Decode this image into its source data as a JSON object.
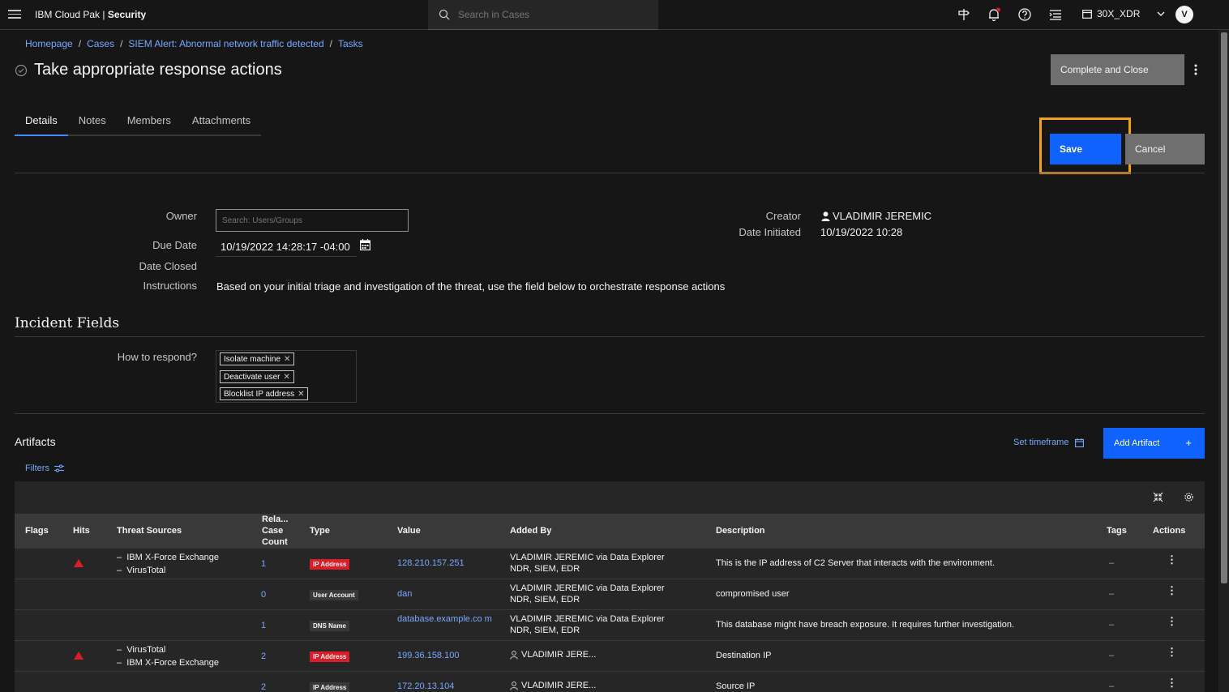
{
  "topbar": {
    "brand_prefix": "IBM Cloud Pak | ",
    "brand_name": "Security",
    "search_placeholder": "Search in Cases",
    "tenant": "30X_XDR",
    "avatar_initial": "V"
  },
  "breadcrumb": [
    "Homepage",
    "Cases",
    "SIEM Alert: Abnormal network traffic detected",
    "Tasks"
  ],
  "breadcrumb_separator": "/",
  "page_title": "Take appropriate response actions",
  "actions": {
    "complete_label": "Complete and Close",
    "save_label": "Save",
    "cancel_label": "Cancel"
  },
  "tabs": [
    "Details",
    "Notes",
    "Members",
    "Attachments"
  ],
  "form": {
    "owner_label": "Owner",
    "owner_placeholder": "Search: Users/Groups",
    "due_label": "Due Date",
    "due_value": "10/19/2022 14:28:17 -04:00",
    "closed_label": "Date Closed",
    "instructions_label": "Instructions",
    "instructions_value": "Based on your initial triage and investigation of the threat, use the field below to orchestrate response actions",
    "creator_label": "Creator",
    "creator_value": "VLADIMIR JEREMIC",
    "initiated_label": "Date Initiated",
    "initiated_value": "10/19/2022 10:28"
  },
  "incident": {
    "title": "Incident Fields",
    "respond_label": "How to respond?",
    "respond_tags": [
      "Isolate machine",
      "Deactivate user",
      "Blocklist IP address"
    ]
  },
  "artifacts": {
    "title": "Artifacts",
    "set_timeframe": "Set timeframe",
    "add_label": "Add Artifact",
    "filters": "Filters",
    "columns": {
      "flags": "Flags",
      "hits": "Hits",
      "threat_sources": "Threat Sources",
      "related_1": "Rela...",
      "related_2": "Case",
      "related_3": "Count",
      "type": "Type",
      "value": "Value",
      "added_by": "Added By",
      "description": "Description",
      "tags": "Tags",
      "actions": "Actions"
    },
    "rows": [
      {
        "hit": true,
        "sources": [
          "IBM X-Force Exchange",
          "VirusTotal"
        ],
        "count": "1",
        "type": "IP Address",
        "type_color": "#da1e28",
        "value": "128.210.157.251",
        "added_by": [
          "VLADIMIR JEREMIC via Data Explorer",
          "NDR, SIEM, EDR"
        ],
        "user_icon": false,
        "description": "This is the IP address of C2 Server that interacts with the environment.",
        "tags": "–"
      },
      {
        "hit": false,
        "sources": [],
        "count": "0",
        "type": "User Account",
        "type_color": "#393939",
        "value": "dan",
        "added_by": [
          "VLADIMIR JEREMIC via Data Explorer",
          "NDR, SIEM, EDR"
        ],
        "user_icon": false,
        "description": "compromised user",
        "tags": "–"
      },
      {
        "hit": false,
        "sources": [],
        "count": "1",
        "type": "DNS Name",
        "type_color": "#393939",
        "value": "database.example.co m",
        "added_by": [
          "VLADIMIR JEREMIC via Data Explorer",
          "NDR, SIEM, EDR"
        ],
        "user_icon": false,
        "description": "This database might have breach exposure. It requires further investigation.",
        "tags": "–"
      },
      {
        "hit": true,
        "sources": [
          "VirusTotal",
          "IBM X-Force Exchange"
        ],
        "count": "2",
        "type": "IP Address",
        "type_color": "#da1e28",
        "value": "199.36.158.100",
        "added_by": [
          "VLADIMIR JERE..."
        ],
        "user_icon": true,
        "description": "Destination IP",
        "tags": "–"
      },
      {
        "hit": false,
        "sources": [],
        "count": "2",
        "type": "IP Address",
        "type_color": "#393939",
        "value": "172.20.13.104",
        "added_by": [
          "VLADIMIR JERE..."
        ],
        "user_icon": true,
        "description": "Source IP",
        "tags": "–"
      }
    ]
  }
}
